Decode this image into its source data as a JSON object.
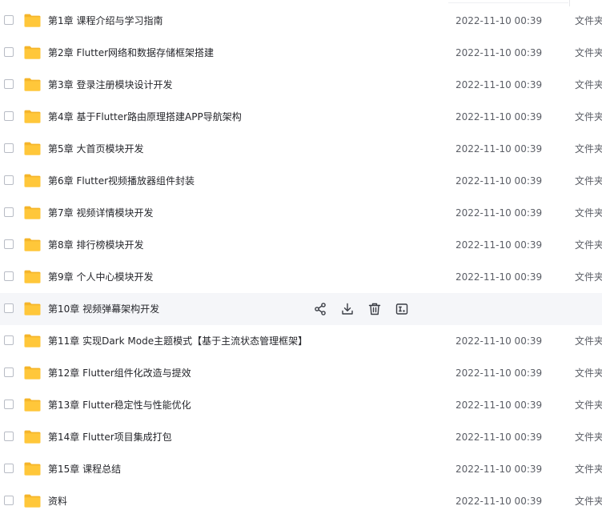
{
  "files": [
    {
      "name": "第1章 课程介绍与学习指南",
      "modified": "2022-11-10 00:39",
      "type": "文件夹"
    },
    {
      "name": "第2章 Flutter网络和数据存储框架搭建",
      "modified": "2022-11-10 00:39",
      "type": "文件夹"
    },
    {
      "name": "第3章 登录注册模块设计开发",
      "modified": "2022-11-10 00:39",
      "type": "文件夹"
    },
    {
      "name": "第4章 基于Flutter路由原理搭建APP导航架构",
      "modified": "2022-11-10 00:39",
      "type": "文件夹"
    },
    {
      "name": "第5章 大首页模块开发",
      "modified": "2022-11-10 00:39",
      "type": "文件夹"
    },
    {
      "name": "第6章 Flutter视频播放器组件封装",
      "modified": "2022-11-10 00:39",
      "type": "文件夹"
    },
    {
      "name": "第7章 视频详情模块开发",
      "modified": "2022-11-10 00:39",
      "type": "文件夹"
    },
    {
      "name": "第8章 排行榜模块开发",
      "modified": "2022-11-10 00:39",
      "type": "文件夹"
    },
    {
      "name": "第9章 个人中心模块开发",
      "modified": "2022-11-10 00:39",
      "type": "文件夹"
    },
    {
      "name": "第10章 视频弹幕架构开发",
      "modified": "",
      "type": "",
      "hovered": true
    },
    {
      "name": "第11章 实现Dark Mode主题模式【基于主流状态管理框架】",
      "modified": "2022-11-10 00:39",
      "type": "文件夹"
    },
    {
      "name": "第12章 Flutter组件化改造与提效",
      "modified": "2022-11-10 00:39",
      "type": "文件夹"
    },
    {
      "name": "第13章 Flutter稳定性与性能优化",
      "modified": "2022-11-10 00:39",
      "type": "文件夹"
    },
    {
      "name": "第14章 Flutter项目集成打包",
      "modified": "2022-11-10 00:39",
      "type": "文件夹"
    },
    {
      "name": "第15章 课程总结",
      "modified": "2022-11-10 00:39",
      "type": "文件夹"
    },
    {
      "name": "资料",
      "modified": "2022-11-10 00:39",
      "type": "文件夹"
    }
  ],
  "row_actions": [
    {
      "icon": "share-icon"
    },
    {
      "icon": "download-icon"
    },
    {
      "icon": "delete-icon"
    },
    {
      "icon": "rename-icon"
    }
  ],
  "colors": {
    "folder": "#ffc73a",
    "folder_back": "#f5b52a",
    "hover_bg": "#f5f6f9",
    "action_icon": "#3a3d45"
  }
}
